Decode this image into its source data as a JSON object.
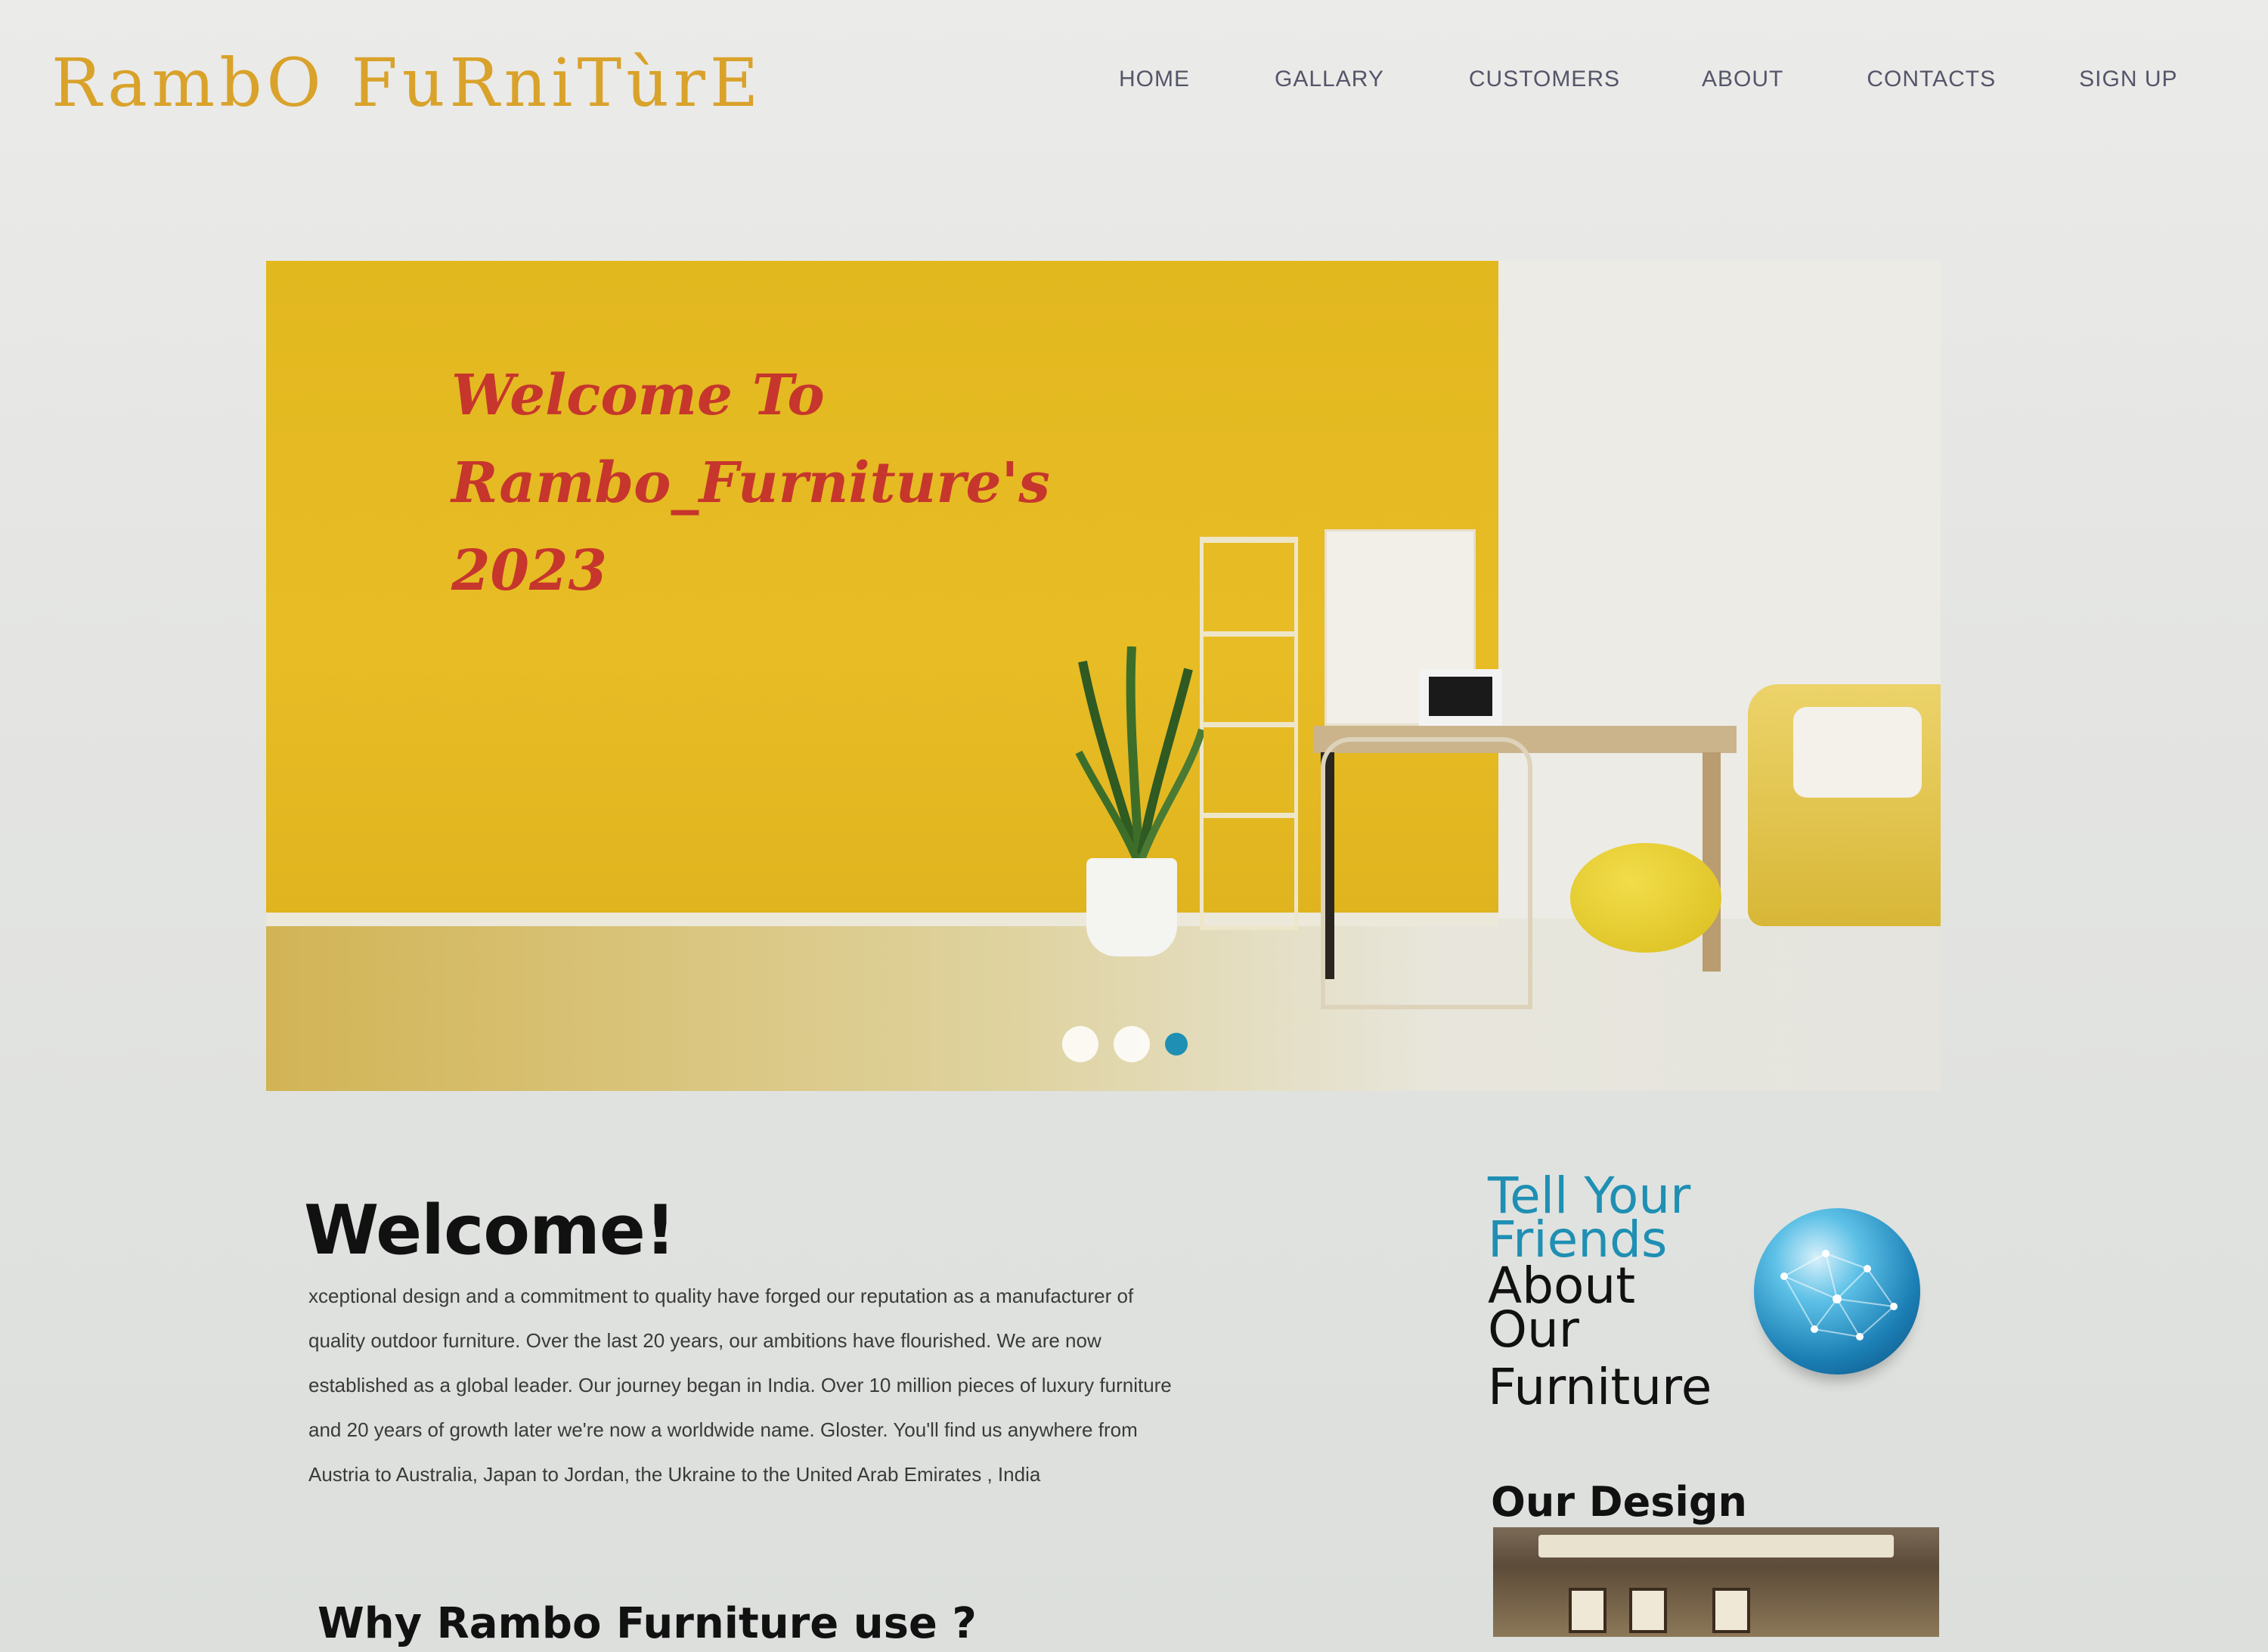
{
  "header": {
    "logo": "RambO FuRniTùrE",
    "nav": [
      "HOME",
      "GALLARY",
      "CUSTOMERS",
      "ABOUT",
      "CONTACTS",
      "SIGN UP"
    ]
  },
  "hero": {
    "title_lines": [
      "Welcome  To",
      "Rambo_Furniture's",
      "2023"
    ],
    "slide_count": 3,
    "active_slide": 3,
    "accent_color": "#1f8fb3",
    "wall_color": "#e2b81f",
    "title_color": "#c6362d"
  },
  "welcome": {
    "title": "Welcome!",
    "lines": [
      "xceptional design and a commitment to quality have forged our reputation as a manufacturer of",
      "quality outdoor furniture. Over the last 20 years, our ambitions have flourished. We are now",
      "established as a global leader. Our journey began in India. Over 10 million pieces of luxury  furniture",
      "and 20 years of growth later we're now a worldwide name. Gloster. You'll find us anywhere from",
      "Austria to Australia, Japan to Jordan, the Ukraine to the United Arab Emirates , India"
    ],
    "why_title": "Why Rambo Furniture use ?"
  },
  "sidebar": {
    "tell_friends": [
      "Tell Your",
      "Friends"
    ],
    "about_furniture": [
      "About",
      "Our",
      "Furniture"
    ],
    "globe_icon": "globe-icon",
    "design_title": "Our Design"
  }
}
